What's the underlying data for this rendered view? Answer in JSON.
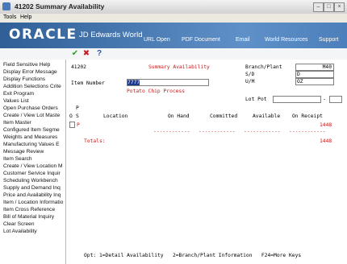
{
  "window": {
    "title": "41202   Summary Availability",
    "icon": "app-icon",
    "controls": [
      "minimize-icon",
      "maximize-icon",
      "close-icon"
    ]
  },
  "menubar": {
    "items": [
      "Tools",
      "Help"
    ]
  },
  "banner": {
    "logo": "ORACLE",
    "product": "JD Edwards World",
    "links": [
      "URL Open",
      "PDF Document",
      "Email",
      "World Resources",
      "Support"
    ]
  },
  "toolbar": {
    "icons": [
      "check-icon",
      "cancel-icon",
      "help-icon"
    ],
    "help_label": "?"
  },
  "left_menu": {
    "items": [
      "Field Sensitive Help",
      "Display Error Message",
      "Display Functions",
      "Addition Selections Crite",
      "Exit Program",
      "Values List",
      "Open Purchase Orders",
      "Create / View Lot Maste",
      "Item Master",
      "Configured Item Segme",
      "Weights and Measures",
      "Manufacturing Values E",
      "Message Review",
      "Item Search",
      "Create / View Location M",
      "Customer Service Inquir",
      "Scheduling Workbench",
      "Supply and Demand Inq",
      "Price and Availability Inq",
      "Item / Location Informatio",
      "Item Cross Reference",
      "Bill of Material Inquiry",
      "Clear Screen",
      "Lot Availability"
    ]
  },
  "form": {
    "program_id": "41202",
    "screen_title": "Summary Availability",
    "item_number_label": "Item Number",
    "item_number_value": "7777",
    "item_description": "Potato Chip Process",
    "branch_label": "Branch/Plant",
    "branch_value": "M40",
    "sd_label": "S/D",
    "sd_value": "D",
    "um_label": "U/M",
    "um_value": "OZ",
    "lot_pot_label": "Lot Pot",
    "lot_pot_separator": "-",
    "columns": {
      "p_top": "P",
      "o": "O",
      "s": "S",
      "location": "Location",
      "on_hand": "On Hand",
      "committed": "Committed",
      "available": "Available",
      "on_receipt": "On Receipt"
    },
    "row": {
      "select": "",
      "p": "P",
      "on_receipt": "1448"
    },
    "dashes": "------------",
    "totals_label": "Totals:",
    "totals_on_receipt": "1448",
    "footer": "Opt: 1=Detail Availability   2=Branch/Plant Information   F24=More Keys"
  }
}
